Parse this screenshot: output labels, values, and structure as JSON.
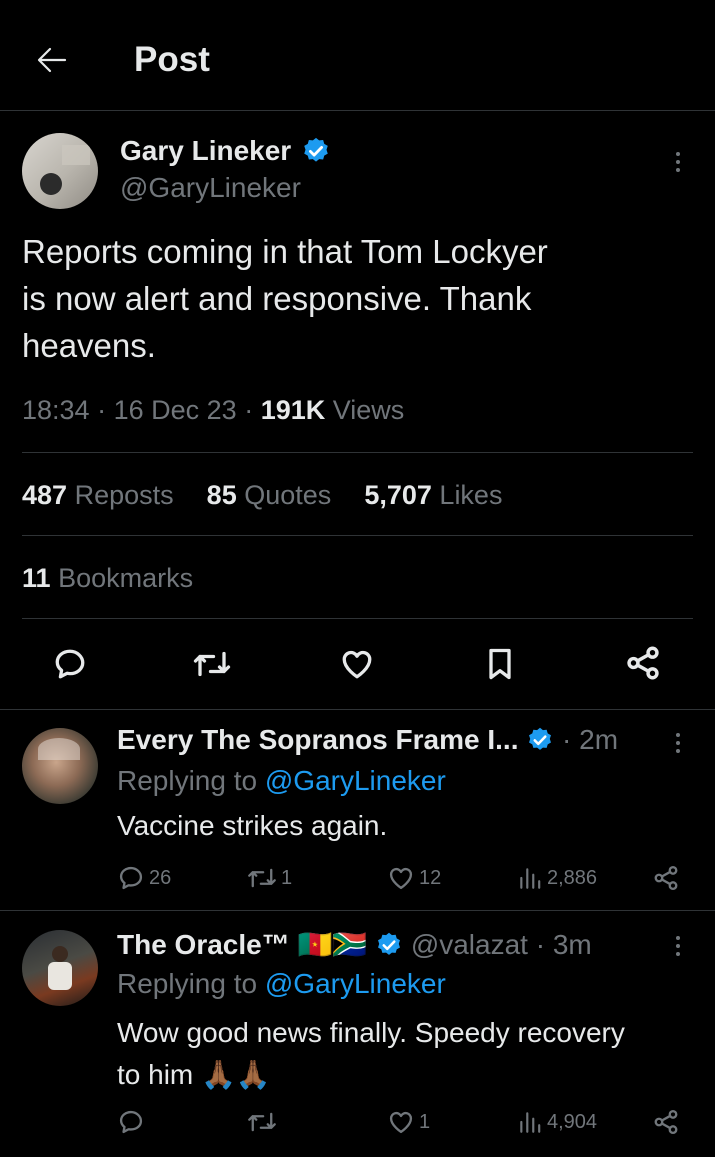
{
  "header": {
    "title": "Post"
  },
  "post": {
    "author_name": "Gary Lineker",
    "author_handle": "@GaryLineker",
    "text_line1": "Reports coming in that Tom Lockyer",
    "text_line2": "is now alert and responsive. Thank",
    "text_line3": "heavens.",
    "time": "18:34",
    "date": "16 Dec 23",
    "views_count": "191K",
    "views_label": "Views",
    "reposts_count": "487",
    "reposts_label": "Reposts",
    "quotes_count": "85",
    "quotes_label": "Quotes",
    "likes_count": "5,707",
    "likes_label": "Likes",
    "bookmarks_count": "11",
    "bookmarks_label": "Bookmarks"
  },
  "replies": [
    {
      "author_name": "Every The Sopranos Frame I...",
      "time": "2m",
      "replying_prefix": "Replying to",
      "replying_handle": "@GaryLineker",
      "text_line1": "Vaccine strikes again.",
      "comments": "26",
      "reposts": "1",
      "likes": "12",
      "views": "2,886"
    },
    {
      "author_name": "The Oracle™",
      "flags": "🇨🇲🇿🇦",
      "author_handle": "@valazat",
      "time": "3m",
      "replying_prefix": "Replying to",
      "replying_handle": "@GaryLineker",
      "text_line1": "Wow good news finally. Speedy recovery",
      "text_line2": "to him 🙏🏾🙏🏾",
      "comments": "",
      "reposts": "",
      "likes": "1",
      "views": "4,904"
    }
  ],
  "colors": {
    "background": "#000000",
    "accent": "#1d9bf0",
    "muted": "#71767b",
    "text": "#e7e9ea",
    "divider": "#2f3336"
  }
}
